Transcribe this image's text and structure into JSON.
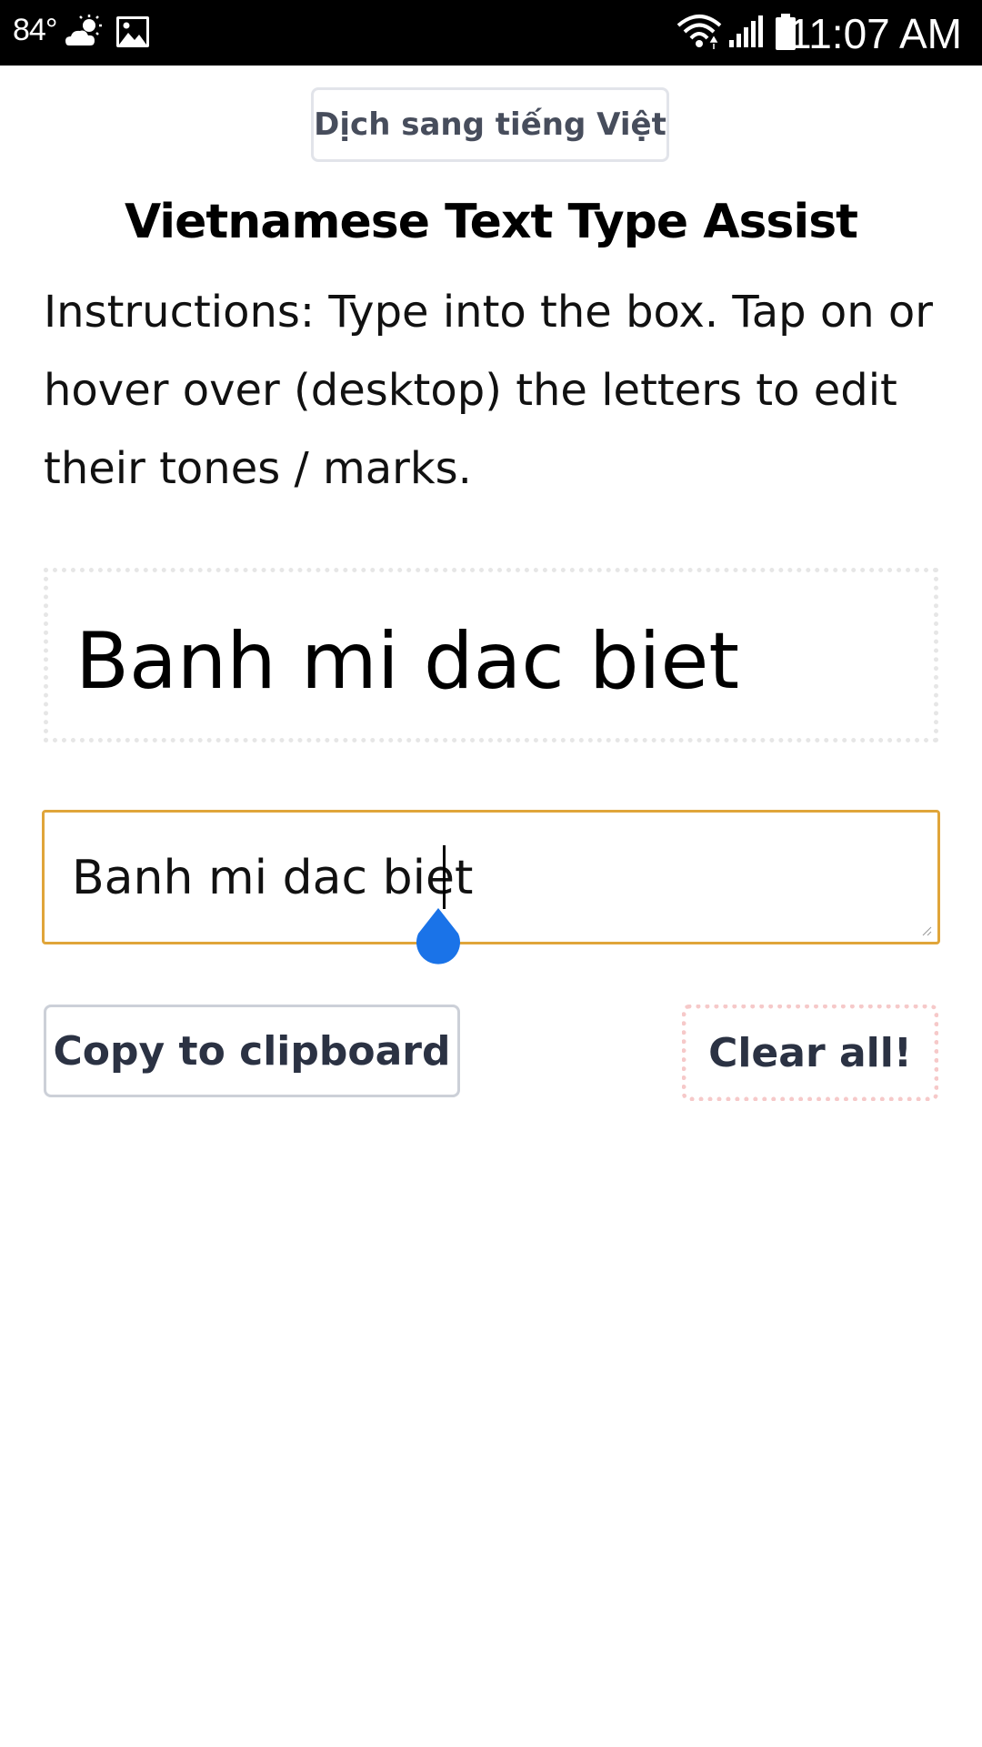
{
  "status_bar": {
    "temperature": "84°",
    "weather_icon": "partly-sunny-icon",
    "notification_icon": "image-icon",
    "wifi_icon": "wifi-icon",
    "signal_icon": "cell-signal-icon",
    "battery_icon": "battery-icon",
    "time": "11:07 AM"
  },
  "header": {
    "translate_label": "Dịch sang tiếng Việt",
    "title": "Vietnamese Text Type Assist",
    "instructions": "Instructions: Type into the box. Tap on or hover over (desktop) the letters to edit their tones / marks."
  },
  "preview": {
    "text": "Banh mi dac biet"
  },
  "input": {
    "value": "Banh mi dac biet"
  },
  "actions": {
    "copy_label": "Copy to clipboard",
    "clear_label": "Clear all!"
  },
  "colors": {
    "input_border": "#e0a53a",
    "cursor_handle": "#1a73e8",
    "clear_border": "#f6c9c9",
    "button_text": "#2b3243"
  }
}
